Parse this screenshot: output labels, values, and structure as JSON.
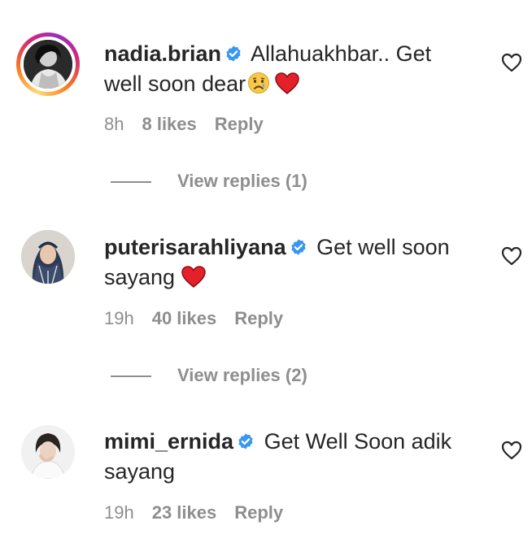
{
  "comments": [
    {
      "username": "nadia.brian",
      "text": "Allahuakhbar.. Get well soon dear",
      "emojis": [
        "sad-face-emoji",
        "red-heart-emoji"
      ],
      "time": "8h",
      "likes": "8 likes",
      "reply": "Reply",
      "view_replies": "View replies (1)"
    },
    {
      "username": "puterisarahliyana",
      "text": "Get well soon sayang",
      "emojis": [
        "red-heart-emoji"
      ],
      "time": "19h",
      "likes": "40 likes",
      "reply": "Reply",
      "view_replies": "View replies (2)"
    },
    {
      "username": "mimi_ernida",
      "text": "Get Well Soon adik sayang",
      "emojis": [],
      "time": "19h",
      "likes": "23 likes",
      "reply": "Reply"
    }
  ],
  "colors": {
    "text": "#262626",
    "meta": "#8e8e8e",
    "verified": "#3897f0",
    "heart": "#ed4956"
  }
}
